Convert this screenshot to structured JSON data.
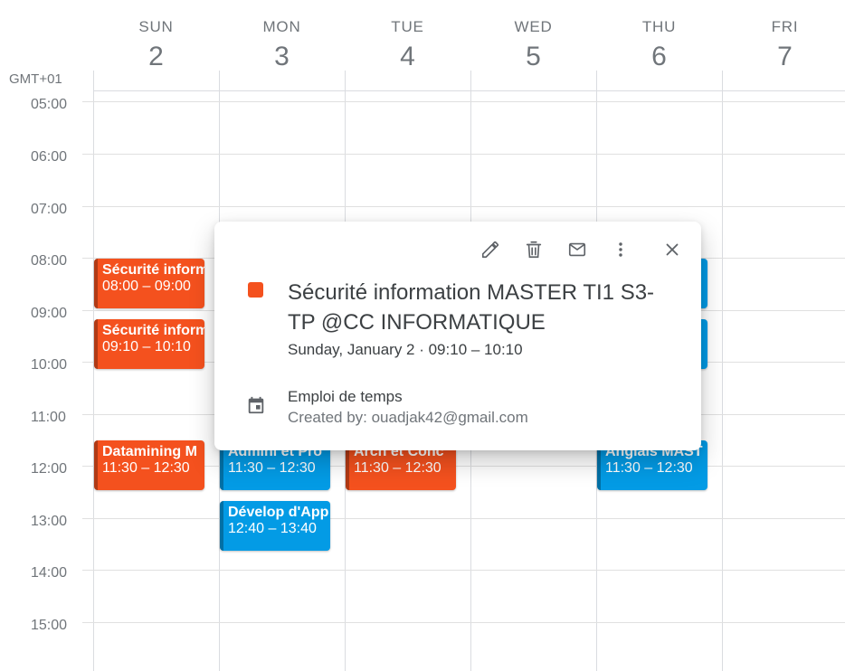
{
  "timezone": "GMT+01",
  "days": [
    {
      "name": "SUN",
      "num": "2"
    },
    {
      "name": "MON",
      "num": "3"
    },
    {
      "name": "TUE",
      "num": "4"
    },
    {
      "name": "WED",
      "num": "5"
    },
    {
      "name": "THU",
      "num": "6"
    },
    {
      "name": "FRI",
      "num": "7"
    }
  ],
  "hours": [
    "05:00",
    "06:00",
    "07:00",
    "08:00",
    "09:00",
    "10:00",
    "11:00",
    "12:00",
    "13:00",
    "14:00",
    "15:00"
  ],
  "events": {
    "sun_a": {
      "title": "Sécurité information MASTER TI1 S3-TP @CC INFORMATIQUE",
      "time": "08:00 – 09:00"
    },
    "sun_b": {
      "title": "Sécurité information MASTER TI1 S3-TP @CC INFORMATIQUE",
      "time": "09:10 – 10:10"
    },
    "sun_c": {
      "title": "Datamining M",
      "time": "11:30 – 12:30"
    },
    "mon_a": {
      "title": "Admini et Pro",
      "time": "11:30 – 12:30"
    },
    "mon_b": {
      "title": "Dévelop d'App",
      "time": "12:40 – 13:40"
    },
    "tue_a": {
      "title": "Arch et Conc",
      "time": "11:30 – 12:30"
    },
    "thu_a": {
      "title": "Anglais MAST",
      "time": "11:30 – 12:30"
    },
    "thu_b": {
      "title": "",
      "time": ""
    },
    "thu_c": {
      "title": "",
      "time": ""
    }
  },
  "event_colors": {
    "orange": "#f4511e",
    "blue": "#039be5"
  },
  "popup": {
    "title": "Sécurité information MASTER TI1 S3-TP @CC INFORMATIQUE",
    "date": "Sunday, January 2  ·  09:10 – 10:10",
    "calendar": "Emploi de temps",
    "created_by": "Created by: ouadjak42@gmail.com",
    "icons": [
      "pencil-icon",
      "trash-icon",
      "mail-icon",
      "more-vert-icon",
      "close-icon",
      "calendar-icon"
    ]
  }
}
